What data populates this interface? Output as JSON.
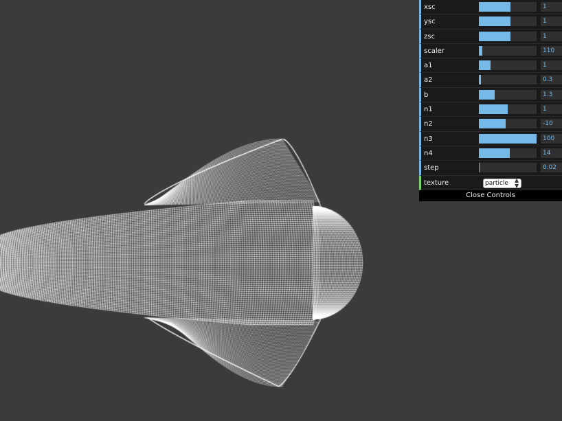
{
  "controls": [
    {
      "key": "xsc",
      "label": "xsc",
      "value": "1",
      "fill": 0.55
    },
    {
      "key": "ysc",
      "label": "ysc",
      "value": "1",
      "fill": 0.55
    },
    {
      "key": "zsc",
      "label": "zsc",
      "value": "1",
      "fill": 0.55
    },
    {
      "key": "scaler",
      "label": "scaler",
      "value": "110",
      "fill": 0.06
    },
    {
      "key": "a1",
      "label": "a1",
      "value": "1",
      "fill": 0.2
    },
    {
      "key": "a2",
      "label": "a2",
      "value": "0.3",
      "fill": 0.04
    },
    {
      "key": "b",
      "label": "b",
      "value": "1.3",
      "fill": 0.27
    },
    {
      "key": "n1",
      "label": "n1",
      "value": "1",
      "fill": 0.5
    },
    {
      "key": "n2",
      "label": "n2",
      "value": "-10",
      "fill": 0.47
    },
    {
      "key": "n3",
      "label": "n3",
      "value": "100",
      "fill": 1.0
    },
    {
      "key": "n4",
      "label": "n4",
      "value": "14",
      "fill": 0.54
    },
    {
      "key": "step",
      "label": "step",
      "value": "0.02",
      "fill": 0.01
    }
  ],
  "texture": {
    "label": "texture",
    "selected": "particle",
    "options": [
      "particle"
    ]
  },
  "close_label": "Close Controls",
  "colors": {
    "background": "#3b3b3b",
    "accent": "#76b8e8",
    "string_accent": "#7fd46e",
    "particle": "#ffffff"
  }
}
